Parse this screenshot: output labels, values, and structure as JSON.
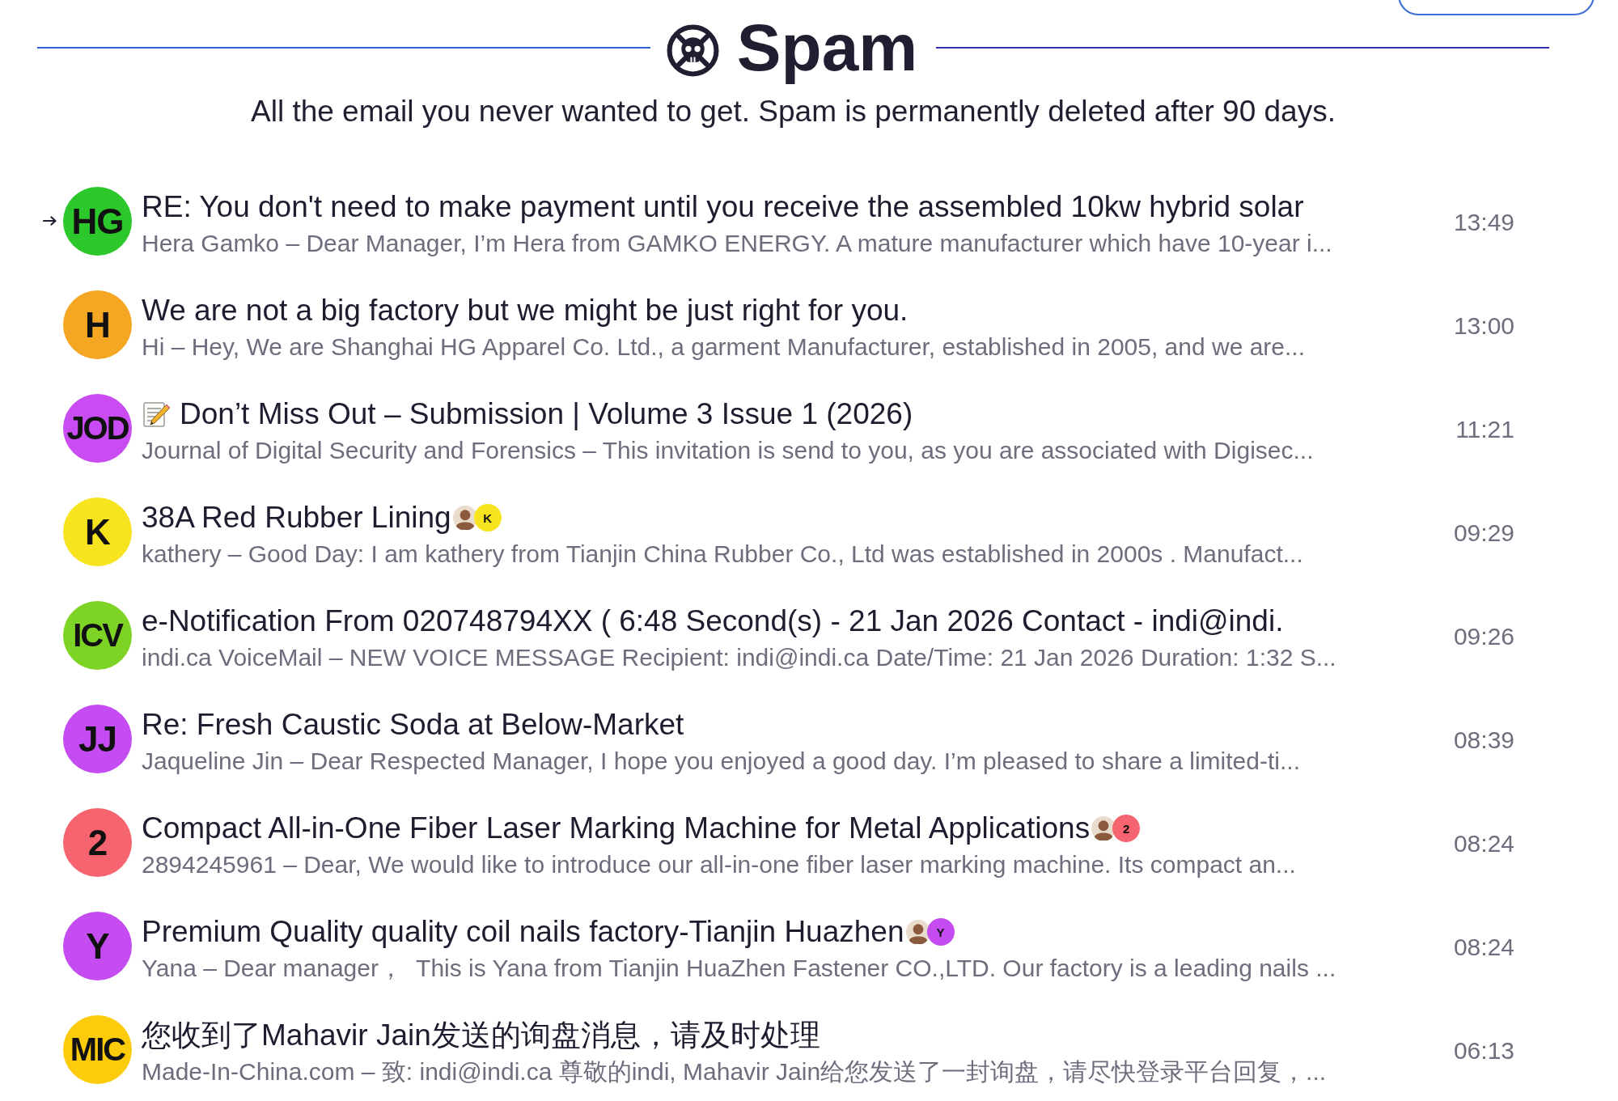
{
  "header": {
    "title": "Spam",
    "subtitle": "All the email you never wanted to get. Spam is permanently deleted after 90 days."
  },
  "messages": [
    {
      "focused": true,
      "avatar": {
        "initials": "HG",
        "color": "#2bc72b"
      },
      "subject_icon": false,
      "subject": "RE: You don't need to make payment until you receive the assembled 10kw hybrid solar",
      "snippet": "Hera Gamko – Dear Manager, I’m Hera from GAMKO ENERGY. A mature manufacturer which have 10-year i...",
      "time": "13:49"
    },
    {
      "focused": false,
      "avatar": {
        "initials": "H",
        "color": "#f5a623"
      },
      "subject_icon": false,
      "subject": "We are not a big factory but we might be just right for you.",
      "snippet": "Hi – Hey, We are Shanghai HG Apparel Co. Ltd., a garment Manufacturer, established in 2005, and we are...",
      "time": "13:00"
    },
    {
      "focused": false,
      "avatar": {
        "initials": "JOD",
        "color": "#c94cf2"
      },
      "subject_icon": true,
      "subject": "Don’t Miss Out – Submission | Volume 3 Issue 1 (2026)",
      "snippet": "Journal of Digital Security and Forensics – This invitation is send to you, as you are associated with Digisec...",
      "time": "11:21"
    },
    {
      "focused": false,
      "avatar": {
        "initials": "K",
        "color": "#f7e41e"
      },
      "subject_icon": false,
      "subject": "38A Red Rubber Lining",
      "participants": [
        {
          "kind": "photo"
        },
        {
          "kind": "initials",
          "initials": "K",
          "color": "#f7e41e"
        }
      ],
      "snippet": "kathery – Good Day: I am kathery from Tianjin China Rubber Co., Ltd was established in 2000s . Manufact...",
      "time": "09:29"
    },
    {
      "focused": false,
      "avatar": {
        "initials": "ICV",
        "color": "#7ed424"
      },
      "subject_icon": false,
      "subject": "e-Notification From 020748794XX ( 6:48 Second(s) - 21 Jan 2026 Contact - indi@indi.",
      "snippet": "indi.ca VoiceMail – NEW VOICE MESSAGE Recipient: indi@indi.ca Date/Time: 21 Jan 2026 Duration: 1:32 S...",
      "time": "09:26"
    },
    {
      "focused": false,
      "avatar": {
        "initials": "JJ",
        "color": "#c44cf2"
      },
      "subject_icon": false,
      "subject": "Re: Fresh Caustic Soda at Below-Market",
      "snippet": "Jaqueline Jin – Dear Respected Manager, I hope you enjoyed a good day. I’m pleased to share a limited-ti...",
      "time": "08:39"
    },
    {
      "focused": false,
      "avatar": {
        "initials": "2",
        "color": "#f6646f"
      },
      "subject_icon": false,
      "subject": "Compact All-in-One Fiber Laser Marking Machine for Metal Applications",
      "participants": [
        {
          "kind": "photo"
        },
        {
          "kind": "initials",
          "initials": "2",
          "color": "#f6646f"
        }
      ],
      "snippet": "2894245961 – Dear, We would like to introduce our all-in-one fiber laser marking machine. Its compact an...",
      "time": "08:24"
    },
    {
      "focused": false,
      "avatar": {
        "initials": "Y",
        "color": "#c44cf0"
      },
      "subject_icon": false,
      "subject": "Premium Quality quality coil nails factory-Tianjin Huazhen",
      "participants": [
        {
          "kind": "photo"
        },
        {
          "kind": "initials",
          "initials": "Y",
          "color": "#c44cf0"
        }
      ],
      "snippet": "Yana – Dear manager，  This is Yana from Tianjin HuaZhen Fastener CO.,LTD. Our factory is a leading nails ...",
      "time": "08:24"
    },
    {
      "focused": false,
      "avatar": {
        "initials": "MIC",
        "color": "#fccb0b"
      },
      "subject_icon": false,
      "subject": "您收到了Mahavir Jain发送的询盘消息，请及时处理",
      "snippet": "Made-In-China.com – 致: indi@indi.ca 尊敬的indi, Mahavir Jain给您发送了一封询盘，请尽快登录平台回复，...",
      "time": "06:13"
    }
  ]
}
